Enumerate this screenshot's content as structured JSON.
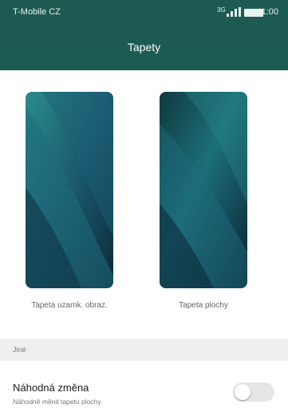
{
  "status_bar": {
    "carrier": "T-Mobile CZ",
    "network": "3G",
    "time": "11:00"
  },
  "header": {
    "title": "Tapety"
  },
  "wallpapers": [
    {
      "label": "Tapeta uzamk. obraz."
    },
    {
      "label": "Tapeta plochy"
    }
  ],
  "sections": {
    "other": "Jiné"
  },
  "settings": {
    "random_change": {
      "title": "Náhodná změna",
      "subtitle": "Náhodně měnit tapetu plochy",
      "enabled": false
    }
  },
  "icons": [
    "signal-icon",
    "battery-icon",
    "toggle-switch"
  ],
  "colors": {
    "header": "#1c5b53",
    "section_bg": "#efefef"
  }
}
